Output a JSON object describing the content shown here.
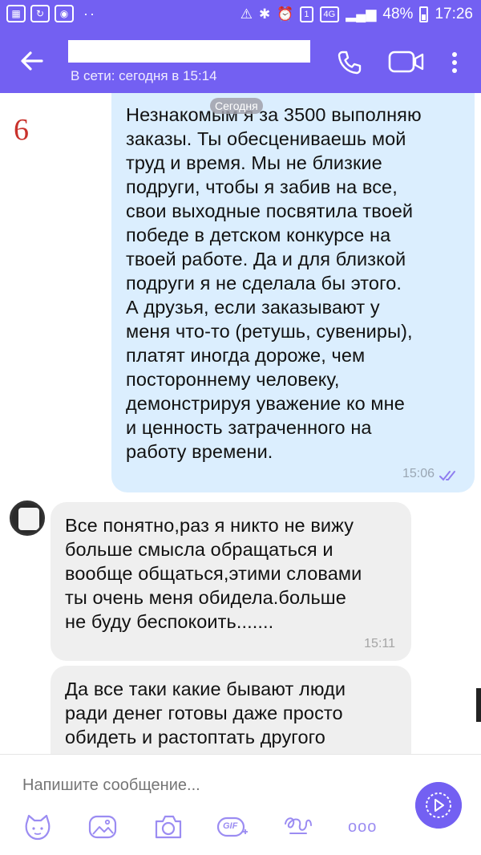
{
  "status_bar": {
    "signal_tag": "4G",
    "battery": "48%",
    "time": "17:26",
    "annot_glyph": "1"
  },
  "header": {
    "presence": "В сети: сегодня в 15:14"
  },
  "annotation": "6",
  "date_chip": "Сегодня",
  "messages": [
    {
      "direction": "outgoing",
      "text": "Незнакомым я за 3500 выполняю\nзаказы. Ты обесцениваешь мой\nтруд и время. Мы не близкие\nподруги, чтобы я забив на все,\nсвои выходные посвятила твоей\nпобеде в детском конкурсе на\nтвоей работе. Да и для близкой\nподруги я не сделала бы этого.\nА друзья, если заказывают у\nменя что-то (ретушь, сувениры),\nплатят иногда дороже, чем\nпостороннему человеку,\nдемонстрируя уважение ко мне\nи ценность затраченного на\nработу времени.",
      "time": "15:06"
    },
    {
      "direction": "incoming",
      "text": "Все понятно,раз я никто не вижу\nбольше смысла обращаться и\nвообще общаться,этими словами\nты очень меня обидела.больше\nне буду беспокоить.......",
      "time": "15:11"
    },
    {
      "direction": "incoming",
      "text": "Да все таки какие бывают люди\nради денег готовы даже просто\nобидеть и растоптать другого",
      "time": ""
    }
  ],
  "input": {
    "placeholder": "Напишите сообщение..."
  },
  "toolbar": {
    "gif_label": "GIF",
    "more_label": "ooo"
  },
  "colors": {
    "brand": "#7360f2",
    "outgoing_bubble": "#dbeefe",
    "incoming_bubble": "#efefef",
    "annotation": "#c9322c"
  }
}
